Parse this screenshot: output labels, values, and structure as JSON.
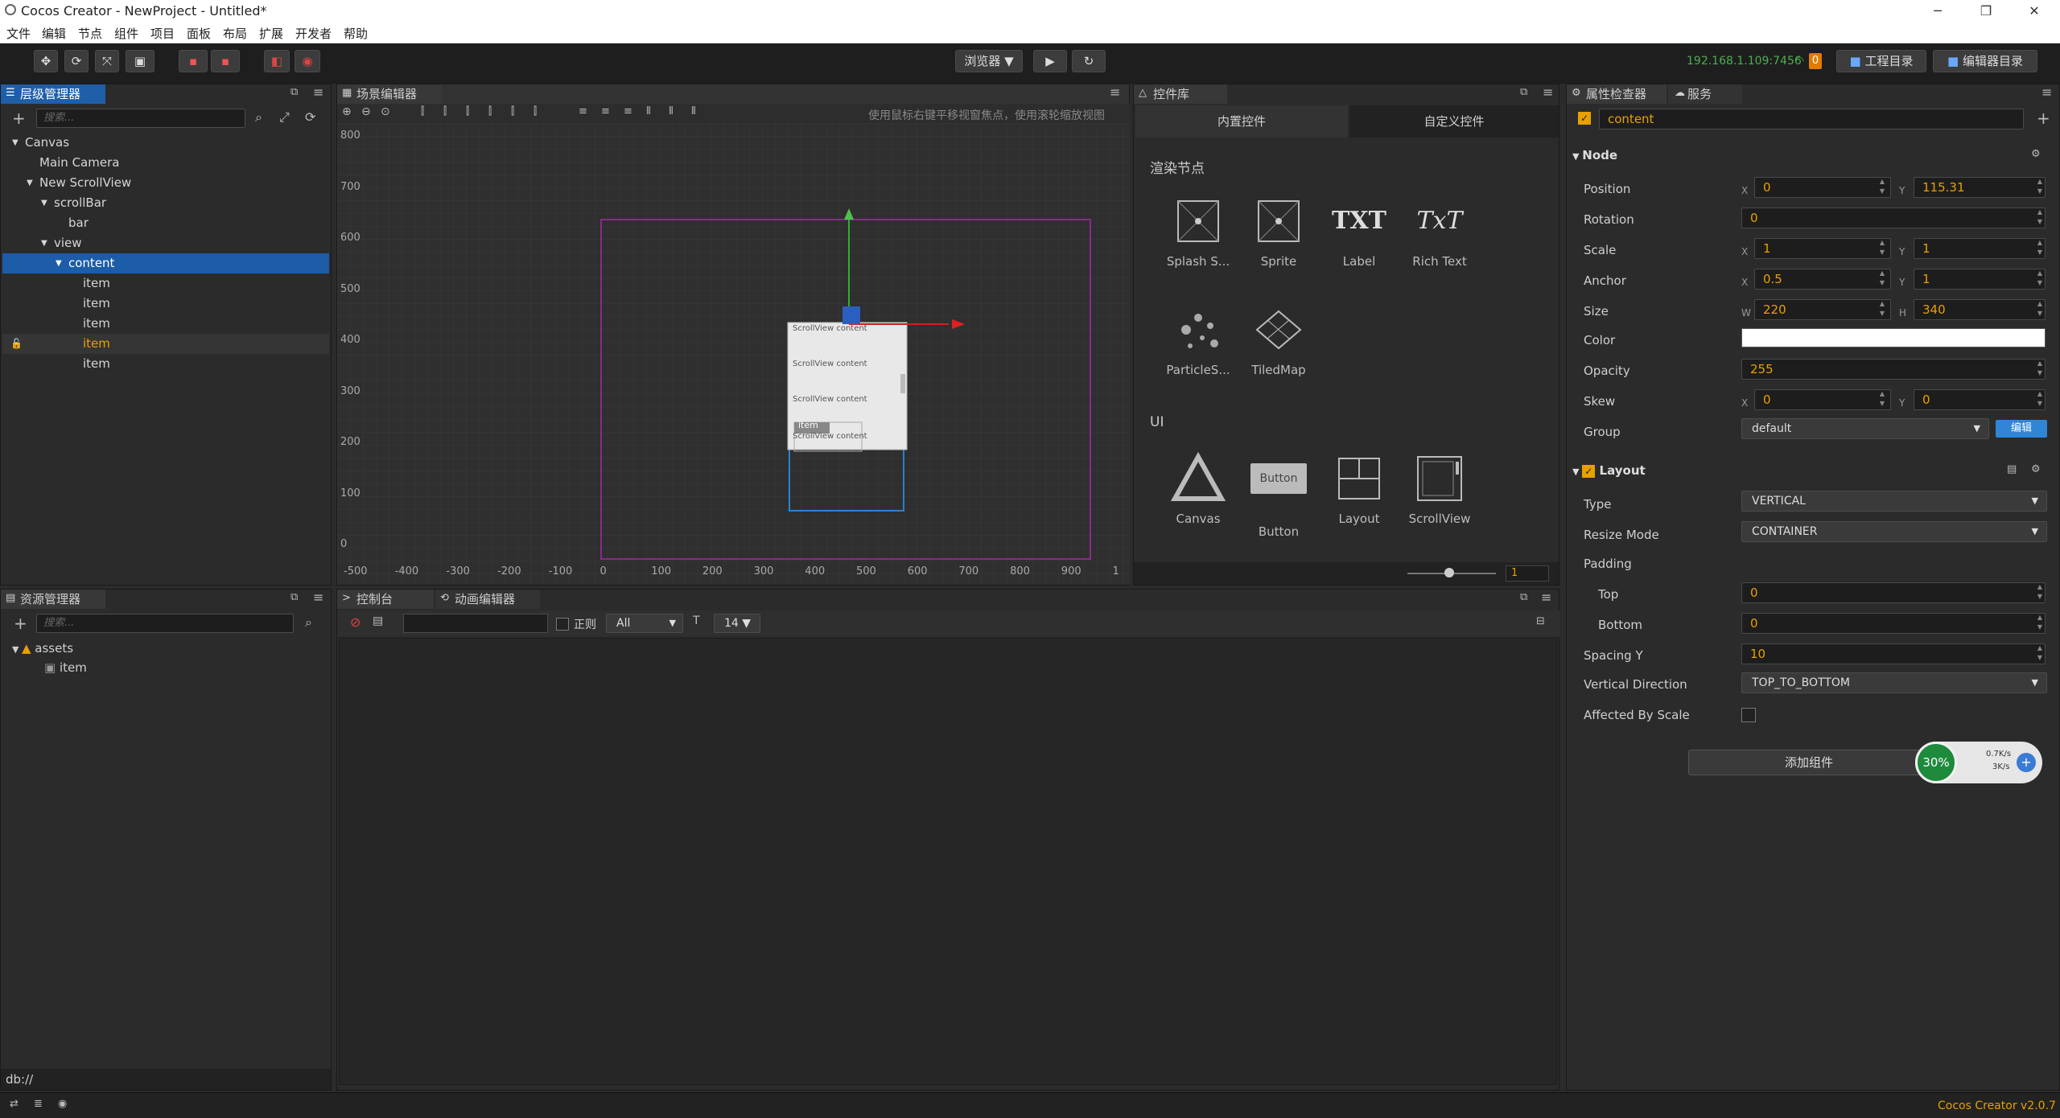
{
  "window": {
    "title": "Cocos Creator - NewProject - Untitled*",
    "min": "─",
    "max": "❐",
    "close": "✕"
  },
  "menu": [
    "文件",
    "编辑",
    "节点",
    "组件",
    "项目",
    "面板",
    "布局",
    "扩展",
    "开发者",
    "帮助"
  ],
  "toolbar": {
    "preview_select": "浏览器 ▼",
    "play": "▶",
    "refresh": "↻",
    "ip": "192.168.1.109:7456",
    "notif_count": "0",
    "project_dir": "工程目录",
    "editor_dir": "编辑器目录"
  },
  "hierarchy": {
    "tab": "层级管理器",
    "search_placeholder": "搜索...",
    "nodes": [
      {
        "label": "Canvas",
        "indent": 0,
        "arrow": "▼"
      },
      {
        "label": "Main Camera",
        "indent": 1,
        "arrow": ""
      },
      {
        "label": "New ScrollView",
        "indent": 1,
        "arrow": "▼"
      },
      {
        "label": "scrollBar",
        "indent": 2,
        "arrow": "▼"
      },
      {
        "label": "bar",
        "indent": 3,
        "arrow": ""
      },
      {
        "label": "view",
        "indent": 2,
        "arrow": "▼"
      },
      {
        "label": "content",
        "indent": 3,
        "arrow": "▼",
        "state": "selected"
      },
      {
        "label": "item",
        "indent": 4,
        "arrow": ""
      },
      {
        "label": "item",
        "indent": 4,
        "arrow": ""
      },
      {
        "label": "item",
        "indent": 4,
        "arrow": ""
      },
      {
        "label": "item",
        "indent": 4,
        "arrow": "",
        "state": "highlight"
      },
      {
        "label": "item",
        "indent": 4,
        "arrow": ""
      }
    ]
  },
  "scene": {
    "tab": "场景编辑器",
    "hint": "使用鼠标右键平移视窗焦点，使用滚轮缩放视图",
    "y_ticks": [
      "800",
      "700",
      "600",
      "500",
      "400",
      "300",
      "200",
      "100",
      "0"
    ],
    "x_ticks": [
      "-500",
      "-400",
      "-300",
      "-200",
      "-100",
      "0",
      "100",
      "200",
      "300",
      "400",
      "500",
      "600",
      "700",
      "800",
      "900",
      "1"
    ],
    "scroll_items": [
      "ScrollView content",
      "ScrollView content",
      "ScrollView content",
      "ScrollView content"
    ],
    "item_label": "item"
  },
  "library": {
    "tab": "控件库",
    "tabs": [
      "内置控件",
      "自定义控件"
    ],
    "section_render": "渲染节点",
    "section_ui": "UI",
    "render_items": [
      "Splash S...",
      "Sprite",
      "Label",
      "Rich Text",
      "ParticleS...",
      "TiledMap"
    ],
    "ui_items": [
      "Canvas",
      "Button",
      "Layout",
      "ScrollView"
    ],
    "label_icon_text": "TXT",
    "richtext_icon_text": "TxT",
    "button_icon_text": "Button",
    "zoom_value": "1"
  },
  "assets": {
    "tab": "资源管理器",
    "search_placeholder": "搜索...",
    "items": [
      "assets",
      "item"
    ],
    "path": "db://"
  },
  "console": {
    "tabs": [
      "控制台",
      "动画编辑器"
    ],
    "regex_label": "正则",
    "level": "All",
    "font_size": "14 ▼"
  },
  "inspector": {
    "tabs": [
      "属性检查器",
      "服务"
    ],
    "node_name": "content",
    "node_section": "Node",
    "position": {
      "label": "Position",
      "x": "0",
      "y": "115.31"
    },
    "rotation": {
      "label": "Rotation",
      "value": "0"
    },
    "scale": {
      "label": "Scale",
      "x": "1",
      "y": "1"
    },
    "anchor": {
      "label": "Anchor",
      "x": "0.5",
      "y": "1"
    },
    "size": {
      "label": "Size",
      "w": "220",
      "h": "340"
    },
    "color": {
      "label": "Color",
      "value": "#ffffff"
    },
    "opacity": {
      "label": "Opacity",
      "value": "255"
    },
    "skew": {
      "label": "Skew",
      "x": "0",
      "y": "0"
    },
    "group": {
      "label": "Group",
      "value": "default",
      "edit": "编辑"
    },
    "layout_section": "Layout",
    "type": {
      "label": "Type",
      "value": "VERTICAL"
    },
    "resize_mode": {
      "label": "Resize Mode",
      "value": "CONTAINER"
    },
    "padding": {
      "label": "Padding",
      "top_label": "Top",
      "top": "0",
      "bottom_label": "Bottom",
      "bottom": "0"
    },
    "spacing_y": {
      "label": "Spacing Y",
      "value": "10"
    },
    "vertical_direction": {
      "label": "Vertical Direction",
      "value": "TOP_TO_BOTTOM"
    },
    "affected_by_scale": {
      "label": "Affected By Scale"
    },
    "add_component": "添加组件",
    "axis_x": "X",
    "axis_y": "Y",
    "axis_w": "W",
    "axis_h": "H"
  },
  "net_widget": {
    "percent": "30%",
    "up": "0.7K/s",
    "down": "3K/s"
  },
  "status": {
    "version": "Cocos Creator v2.0.7"
  },
  "colors": {
    "accent": "#1f5fa8",
    "selection": "#1c5ca8",
    "value_orange": "#e8a000",
    "ip_green": "#4caf50"
  }
}
